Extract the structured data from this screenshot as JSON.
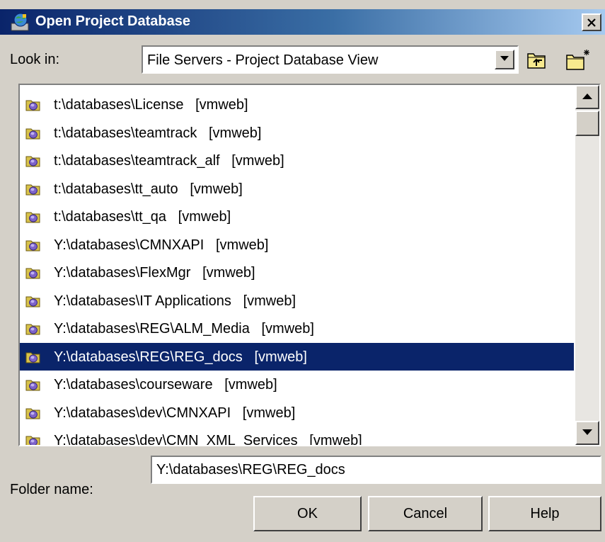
{
  "window": {
    "title": "Open Project Database",
    "icon": "app-globe-icon",
    "close_icon": "close-icon"
  },
  "look_in": {
    "label": "Look in:",
    "value": "File Servers - Project Database View",
    "up_folder_icon": "up-folder-icon",
    "new_folder_icon": "new-folder-icon"
  },
  "folders": {
    "item_icon": "database-folder-icon",
    "items": [
      {
        "label": "t:\\databases\\License   [vmweb]"
      },
      {
        "label": "t:\\databases\\teamtrack   [vmweb]"
      },
      {
        "label": "t:\\databases\\teamtrack_alf   [vmweb]"
      },
      {
        "label": "t:\\databases\\tt_auto   [vmweb]"
      },
      {
        "label": "t:\\databases\\tt_qa   [vmweb]"
      },
      {
        "label": "Y:\\databases\\CMNXAPI   [vmweb]"
      },
      {
        "label": "Y:\\databases\\FlexMgr   [vmweb]"
      },
      {
        "label": "Y:\\databases\\IT Applications   [vmweb]"
      },
      {
        "label": "Y:\\databases\\REG\\ALM_Media   [vmweb]"
      },
      {
        "label": "Y:\\databases\\REG\\REG_docs   [vmweb]"
      },
      {
        "label": "Y:\\databases\\courseware   [vmweb]"
      },
      {
        "label": "Y:\\databases\\dev\\CMNXAPI   [vmweb]"
      },
      {
        "label": "Y:\\databases\\dev\\CMN_XML_Services   [vmweb]"
      }
    ],
    "selected_index": 9
  },
  "folder_name": {
    "label": "Folder name:",
    "value": "Y:\\databases\\REG\\REG_docs"
  },
  "buttons": {
    "ok": "OK",
    "cancel": "Cancel",
    "help": "Help"
  },
  "colors": {
    "selection": "#0a246a",
    "dialog_bg": "#d4d0c8"
  }
}
